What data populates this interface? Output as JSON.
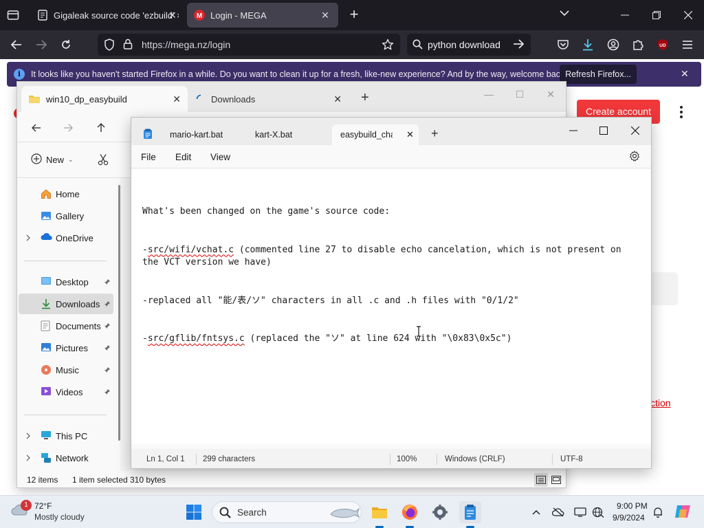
{
  "firefox": {
    "tabs": [
      {
        "title": "Gigaleak source code 'ezbuild' ×",
        "favicon": "document-icon"
      },
      {
        "title": "Login - MEGA",
        "favicon": "mega-logo-icon"
      }
    ],
    "url": "https://mega.nz/login",
    "search_text": "python download",
    "extension_badge": "UD",
    "notification": {
      "text": "It looks like you haven't started Firefox in a while. Do you want to clean it up for a fresh, like-new experience? And by the way, welcome back!",
      "button": "Refresh Firefox..."
    }
  },
  "mega": {
    "create_account": "Create account",
    "partial_link": "ction",
    "brand_color": "#f0373a"
  },
  "explorer": {
    "tabs": [
      {
        "title": "win10_dp_easybuild"
      },
      {
        "title": "Downloads"
      }
    ],
    "new_label": "New",
    "nav": [
      {
        "label": "Home",
        "icon": "home-icon"
      },
      {
        "label": "Gallery",
        "icon": "gallery-icon"
      },
      {
        "label": "OneDrive",
        "icon": "cloud-icon"
      },
      {
        "label": "Desktop",
        "icon": "desktop-icon"
      },
      {
        "label": "Downloads",
        "icon": "download-icon"
      },
      {
        "label": "Documents",
        "icon": "document-icon"
      },
      {
        "label": "Pictures",
        "icon": "pictures-icon"
      },
      {
        "label": "Music",
        "icon": "music-icon"
      },
      {
        "label": "Videos",
        "icon": "videos-icon"
      },
      {
        "label": "This PC",
        "icon": "monitor-icon"
      },
      {
        "label": "Network",
        "icon": "network-icon"
      }
    ],
    "status": {
      "items": "12 items",
      "selected": "1 item selected",
      "size": "310 bytes"
    }
  },
  "notepad": {
    "tabs": [
      {
        "title": "mario-kart.bat"
      },
      {
        "title": "kart-X.bat"
      },
      {
        "title": "easybuild_cha"
      }
    ],
    "menu": [
      "File",
      "Edit",
      "View"
    ],
    "lines": [
      "What's been changed on the game's source code:",
      "-src/wifi/vchat.c (commented line 27 to disable echo cancelation, which is not present on the VCT version we have)",
      "-replaced all \"能/表/ソ\" characters in all .c and .h files with \"0/1/2\"",
      "-src/gflib/fntsys.c (replaced the \"ソ\" at line 624 with \"\\0x83\\0x5c\")"
    ],
    "squiggle_words": [
      "src/wifi/vchat.c",
      "src/gflib/fntsys.c"
    ],
    "status": {
      "position": "Ln 1, Col 1",
      "chars": "299 characters",
      "zoom": "100%",
      "line_ending": "Windows (CRLF)",
      "encoding": "UTF-8"
    }
  },
  "taskbar": {
    "weather_badge": "1",
    "temperature": "72°F",
    "weather": "Mostly cloudy",
    "search_label": "Search",
    "time": "9:00 PM",
    "date": "9/9/2024",
    "accent": "#0067c0"
  }
}
